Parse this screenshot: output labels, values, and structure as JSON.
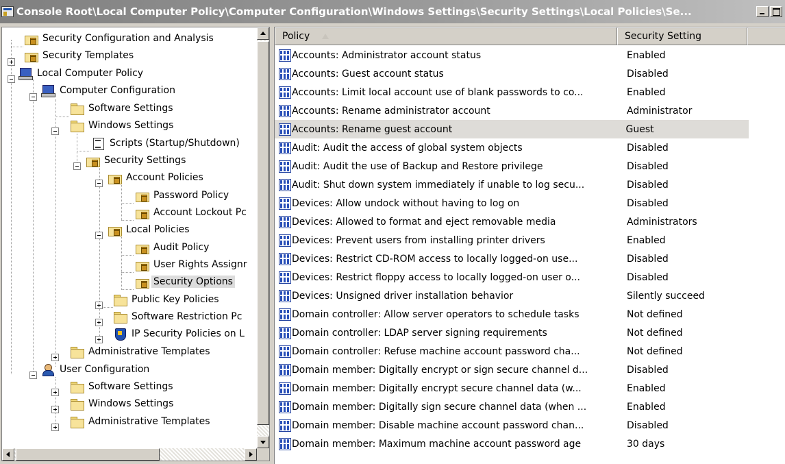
{
  "window": {
    "title": "Console Root\\Local Computer Policy\\Computer Configuration\\Windows Settings\\Security Settings\\Local Policies\\Se..."
  },
  "tree": {
    "items": [
      {
        "label": "Security Configuration and Analysis",
        "icon": "lock-folder-icon"
      },
      {
        "label": "Security Templates",
        "icon": "lock-folder-icon"
      },
      {
        "label": "Local Computer Policy",
        "icon": "computer-policy-icon"
      },
      {
        "label": "Computer Configuration",
        "icon": "computer-icon"
      },
      {
        "label": "Software Settings",
        "icon": "folder-icon"
      },
      {
        "label": "Windows Settings",
        "icon": "folder-icon"
      },
      {
        "label": "Scripts (Startup/Shutdown)",
        "icon": "script-icon"
      },
      {
        "label": "Security Settings",
        "icon": "lock-folder-icon"
      },
      {
        "label": "Account Policies",
        "icon": "lock-folder-icon"
      },
      {
        "label": "Password Policy",
        "icon": "lock-folder-icon"
      },
      {
        "label": "Account Lockout Pc",
        "icon": "lock-folder-icon"
      },
      {
        "label": "Local Policies",
        "icon": "lock-folder-icon"
      },
      {
        "label": "Audit Policy",
        "icon": "lock-folder-icon"
      },
      {
        "label": "User Rights Assignr",
        "icon": "lock-folder-icon"
      },
      {
        "label": "Security Options",
        "icon": "lock-folder-icon"
      },
      {
        "label": "Public Key Policies",
        "icon": "folder-icon"
      },
      {
        "label": "Software Restriction Pc",
        "icon": "folder-icon"
      },
      {
        "label": "IP Security Policies on L",
        "icon": "shield-icon"
      },
      {
        "label": "Administrative Templates",
        "icon": "folder-icon"
      },
      {
        "label": "User Configuration",
        "icon": "user-icon"
      },
      {
        "label": "Software Settings",
        "icon": "folder-icon"
      },
      {
        "label": "Windows Settings",
        "icon": "folder-icon"
      },
      {
        "label": "Administrative Templates",
        "icon": "folder-icon"
      }
    ]
  },
  "list": {
    "columns": [
      "Policy",
      "Security Setting"
    ],
    "rows": [
      {
        "policy": "Accounts: Administrator account status",
        "setting": "Enabled"
      },
      {
        "policy": "Accounts: Guest account status",
        "setting": "Disabled"
      },
      {
        "policy": "Accounts: Limit local account use of blank passwords to co...",
        "setting": "Enabled"
      },
      {
        "policy": "Accounts: Rename administrator account",
        "setting": "Administrator"
      },
      {
        "policy": "Accounts: Rename guest account",
        "setting": "Guest"
      },
      {
        "policy": "Audit: Audit the access of global system objects",
        "setting": "Disabled"
      },
      {
        "policy": "Audit: Audit the use of Backup and Restore privilege",
        "setting": "Disabled"
      },
      {
        "policy": "Audit: Shut down system immediately if unable to log secu...",
        "setting": "Disabled"
      },
      {
        "policy": "Devices: Allow undock without having to log on",
        "setting": "Disabled"
      },
      {
        "policy": "Devices: Allowed to format and eject removable media",
        "setting": "Administrators"
      },
      {
        "policy": "Devices: Prevent users from installing printer drivers",
        "setting": "Enabled"
      },
      {
        "policy": "Devices: Restrict CD-ROM access to locally logged-on use...",
        "setting": "Disabled"
      },
      {
        "policy": "Devices: Restrict floppy access to locally logged-on user o...",
        "setting": "Disabled"
      },
      {
        "policy": "Devices: Unsigned driver installation behavior",
        "setting": "Silently succeed"
      },
      {
        "policy": "Domain controller: Allow server operators to schedule tasks",
        "setting": "Not defined"
      },
      {
        "policy": "Domain controller: LDAP server signing requirements",
        "setting": "Not defined"
      },
      {
        "policy": "Domain controller: Refuse machine account password cha...",
        "setting": "Not defined"
      },
      {
        "policy": "Domain member: Digitally encrypt or sign secure channel d...",
        "setting": "Disabled"
      },
      {
        "policy": "Domain member: Digitally encrypt secure channel data (w...",
        "setting": "Enabled"
      },
      {
        "policy": "Domain member: Digitally sign secure channel data (when ...",
        "setting": "Enabled"
      },
      {
        "policy": "Domain member: Disable machine account password chan...",
        "setting": "Disabled"
      },
      {
        "policy": "Domain member: Maximum machine account password age",
        "setting": "30 days"
      }
    ]
  },
  "colors": {
    "selection": "#dedcd8",
    "window_bg": "#d4d0c8",
    "policy_icon": "#2a50b8"
  }
}
